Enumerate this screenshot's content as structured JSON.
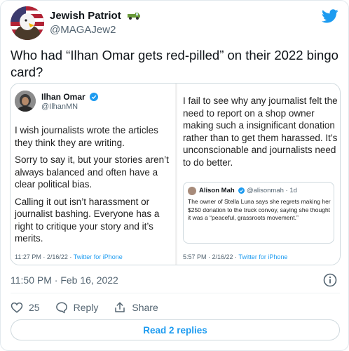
{
  "colors": {
    "accent": "#1d9bf0",
    "text": "#0f1419",
    "muted": "#536471"
  },
  "author": {
    "name": "Jewish Patriot",
    "handle": "@MAGAJew2",
    "badge_icon": "pickup-truck-icon"
  },
  "tweet": {
    "text": "Who had “Ilhan Omar gets red-pilled” on their 2022 bingo card?"
  },
  "media": {
    "left": {
      "name": "Ilhan Omar",
      "handle": "@IlhanMN",
      "paragraphs": [
        "I wish journalists wrote the articles they think they are writing.",
        "Sorry to say it, but your stories aren’t always balanced and often have a clear political bias.",
        "Calling it out isn’t harassment or journalist bashing. Everyone has a right to critique your story and it’s merits."
      ],
      "time": "11:27 PM · 2/16/22 · ",
      "source": "Twitter for iPhone"
    },
    "right": {
      "text": "I fail to see why any journalist felt the need to report on a shop owner making such a insignificant donation rather than to get them harassed. It’s unconscionable and journalists need to do better.",
      "quote": {
        "name": "Alison Mah",
        "handle": "@alisonmah · 1d",
        "text": "The owner of Stella Luna says she regrets making her $250 donation to the truck convoy, saying she thought it was a “peaceful, grassroots movement.”"
      },
      "time": "5:57 PM · 2/16/22 · ",
      "source": "Twitter for iPhone"
    }
  },
  "timestamp": "11:50 PM · Feb 16, 2022",
  "actions": {
    "like_count": "25",
    "reply_label": "Reply",
    "share_label": "Share"
  },
  "read_replies": "Read 2 replies"
}
